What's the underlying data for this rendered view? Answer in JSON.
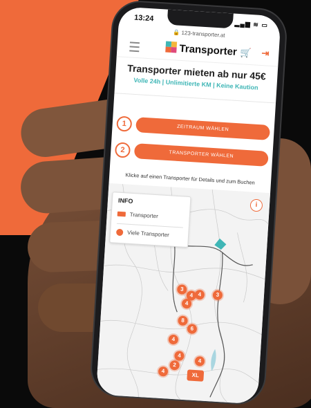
{
  "status": {
    "time": "13:24",
    "icons": "▂▄▆ ≋ ▭"
  },
  "url": "🔒 123-transporter.at",
  "nav": {
    "brand": "Transporter",
    "cart_icon": "cart-icon",
    "login_icon": "login-icon"
  },
  "hero": {
    "headline": "Transporter mieten ab nur 45€",
    "subline": "Volle 24h | Unlimitierte KM | Keine Kaution"
  },
  "steps": [
    {
      "num": "1",
      "label": "ZEITRAUM WÄHLEN"
    },
    {
      "num": "2",
      "label": "TRANSPORTER WÄHLEN"
    }
  ],
  "hint": "Klicke auf einen Transporter für Details und zum Buchen",
  "map": {
    "info_title": "INFO",
    "legend": [
      {
        "label": "Transporter"
      },
      {
        "label": "Viele Transporter"
      }
    ],
    "info_icon": "i",
    "markers": [
      "3",
      "4",
      "4",
      "4",
      "3",
      "8",
      "6",
      "4",
      "4",
      "2",
      "4",
      "4"
    ],
    "xl_label": "XL"
  },
  "colors": {
    "accent": "#ef6a3a",
    "teal": "#3fb6b6"
  }
}
